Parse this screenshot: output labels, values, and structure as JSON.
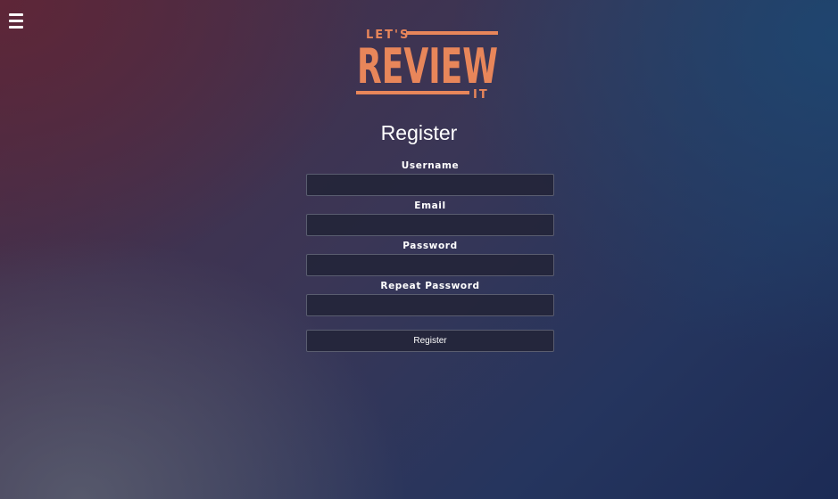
{
  "logo": {
    "line1": "LET'S",
    "line2": "REVIEW",
    "line3": "IT",
    "color": "#e8865a"
  },
  "page": {
    "title": "Register"
  },
  "form": {
    "fields": [
      {
        "label": "Username",
        "value": ""
      },
      {
        "label": "Email",
        "value": ""
      },
      {
        "label": "Password",
        "value": ""
      },
      {
        "label": "Repeat Password",
        "value": ""
      }
    ],
    "submit_label": "Register"
  },
  "icons": {
    "menu": "hamburger-menu-icon"
  },
  "colors": {
    "text": "#ffffff",
    "accent": "#e8865a",
    "input_bg": "#24253a",
    "input_border": "#5a5d70"
  }
}
